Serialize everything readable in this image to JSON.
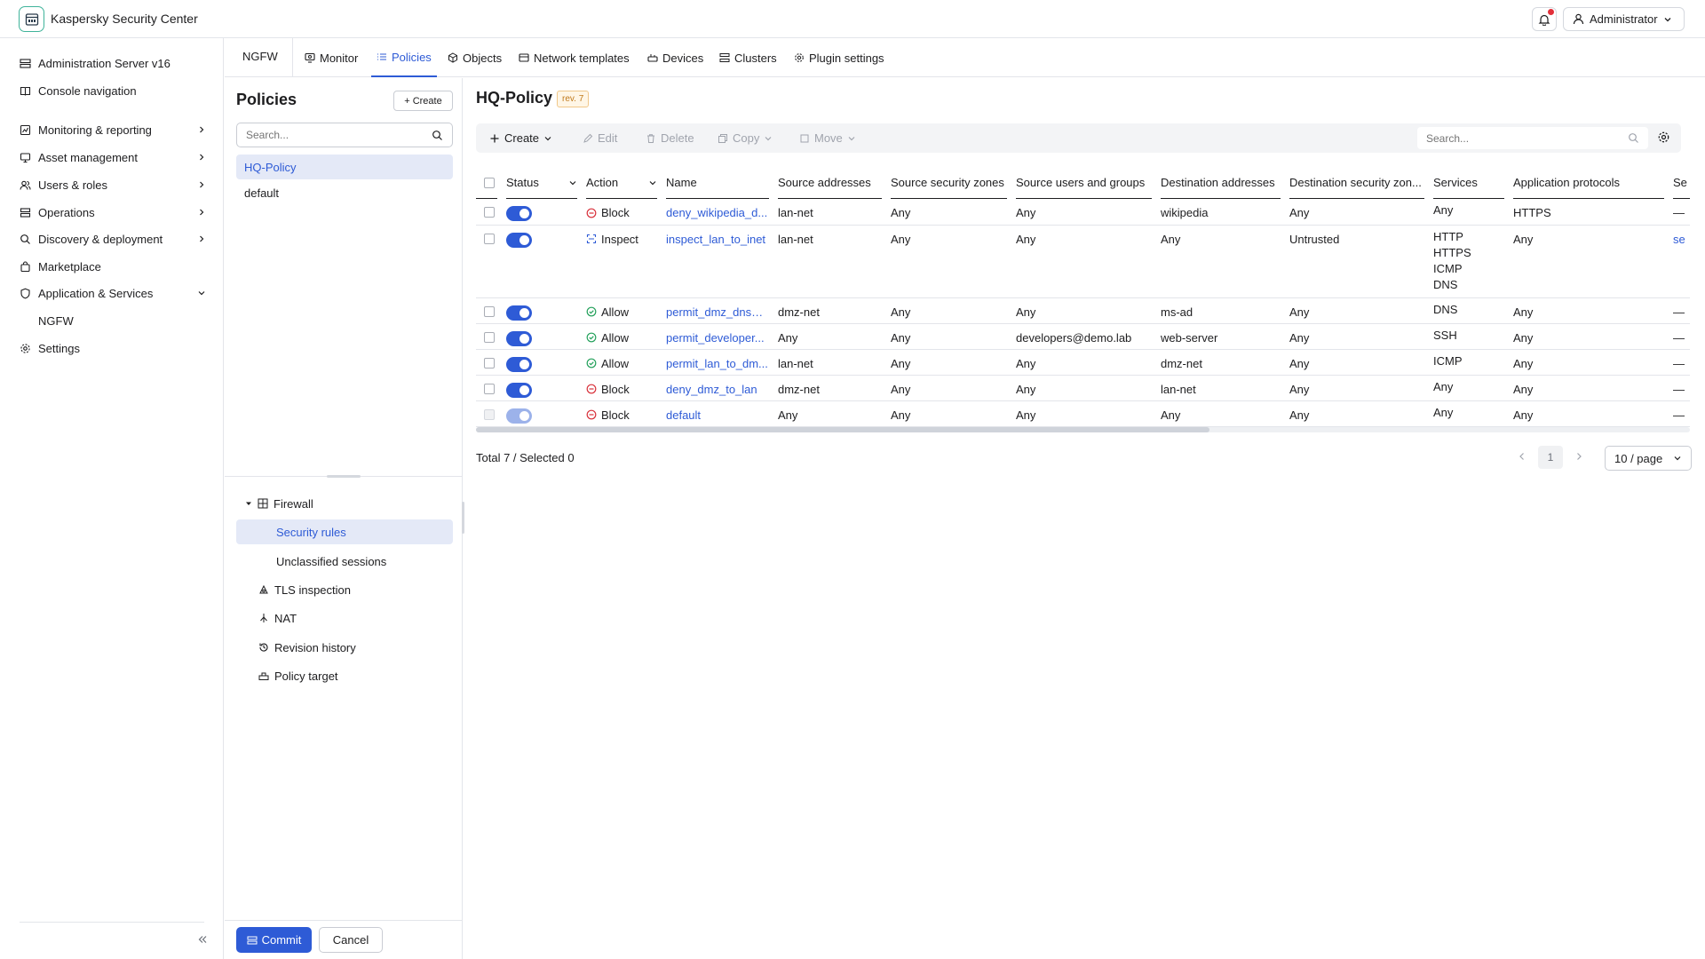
{
  "app": {
    "title": "Kaspersky Security Center",
    "accent": "#2e5bd6",
    "brand": "#3fb39a"
  },
  "header": {
    "user": "Administrator",
    "has_notification": true
  },
  "sidebar": {
    "items": [
      {
        "label": "Administration Server v16",
        "icon": "server-icon",
        "chevron": ""
      },
      {
        "label": "Console navigation",
        "icon": "book-icon",
        "chevron": ""
      },
      {
        "label": "Monitoring & reporting",
        "icon": "chart-icon",
        "chevron": "right"
      },
      {
        "label": "Asset management",
        "icon": "monitor-icon",
        "chevron": "right"
      },
      {
        "label": "Users & roles",
        "icon": "users-icon",
        "chevron": "right"
      },
      {
        "label": "Operations",
        "icon": "list-icon",
        "chevron": "right"
      },
      {
        "label": "Discovery & deployment",
        "icon": "search-icon",
        "chevron": "right"
      },
      {
        "label": "Marketplace",
        "icon": "bag-icon",
        "chevron": ""
      },
      {
        "label": "Application & Services",
        "icon": "shield-icon",
        "chevron": "down"
      },
      {
        "label": "NGFW",
        "icon": "",
        "chevron": ""
      },
      {
        "label": "Settings",
        "icon": "gear-icon",
        "chevron": ""
      }
    ]
  },
  "tabs": {
    "ngfw": "NGFW",
    "items": [
      {
        "label": "Monitor",
        "icon": "monitor-icon",
        "active": false
      },
      {
        "label": "Policies",
        "icon": "list-icon",
        "active": true
      },
      {
        "label": "Objects",
        "icon": "cube-icon",
        "active": false
      },
      {
        "label": "Network templates",
        "icon": "template-icon",
        "active": false
      },
      {
        "label": "Devices",
        "icon": "device-icon",
        "active": false
      },
      {
        "label": "Clusters",
        "icon": "cluster-icon",
        "active": false
      },
      {
        "label": "Plugin settings",
        "icon": "gear-icon",
        "active": false
      }
    ]
  },
  "policies_panel": {
    "title": "Policies",
    "create_label": "Create",
    "search_placeholder": "Search...",
    "items": [
      "HQ-Policy",
      "default"
    ],
    "selected": "HQ-Policy",
    "tree": {
      "firewall": "Firewall",
      "security_rules": "Security rules",
      "unclassified": "Unclassified sessions",
      "tls": "TLS inspection",
      "nat": "NAT",
      "revision_history": "Revision history",
      "policy_target": "Policy target"
    },
    "commit_label": "Commit",
    "cancel_label": "Cancel"
  },
  "main": {
    "title": "HQ-Policy",
    "revision": "rev. 7",
    "toolbar": {
      "create": "Create",
      "edit": "Edit",
      "delete": "Delete",
      "copy": "Copy",
      "move": "Move",
      "search_placeholder": "Search..."
    },
    "columns": [
      "Status",
      "Action",
      "Name",
      "Source addresses",
      "Source security zones",
      "Source users and groups",
      "Destination addresses",
      "Destination security zon...",
      "Services",
      "Application protocols",
      "Se"
    ],
    "rows": [
      {
        "enabled": true,
        "disabled_row": false,
        "action": "Block",
        "name": "deny_wikipedia_d...",
        "src": "lan-net",
        "src_zone": "Any",
        "src_users": "Any",
        "dst": "wikipedia",
        "dst_zone": "Any",
        "services": [
          "Any"
        ],
        "app_proto": "HTTPS",
        "extra": "—"
      },
      {
        "enabled": true,
        "disabled_row": false,
        "action": "Inspect",
        "name": "inspect_lan_to_inet",
        "src": "lan-net",
        "src_zone": "Any",
        "src_users": "Any",
        "dst": "Any",
        "dst_zone": "Untrusted",
        "services": [
          "HTTP",
          "HTTPS",
          "ICMP",
          "DNS"
        ],
        "app_proto": "Any",
        "extra": "se"
      },
      {
        "enabled": true,
        "disabled_row": false,
        "action": "Allow",
        "name": "permit_dmz_dns_ad",
        "src": "dmz-net",
        "src_zone": "Any",
        "src_users": "Any",
        "dst": "ms-ad",
        "dst_zone": "Any",
        "services": [
          "DNS"
        ],
        "app_proto": "Any",
        "extra": "—"
      },
      {
        "enabled": true,
        "disabled_row": false,
        "action": "Allow",
        "name": "permit_developer...",
        "src": "Any",
        "src_zone": "Any",
        "src_users": "developers@demo.lab",
        "dst": "web-server",
        "dst_zone": "Any",
        "services": [
          "SSH"
        ],
        "app_proto": "Any",
        "extra": "—"
      },
      {
        "enabled": true,
        "disabled_row": false,
        "action": "Allow",
        "name": "permit_lan_to_dm...",
        "src": "lan-net",
        "src_zone": "Any",
        "src_users": "Any",
        "dst": "dmz-net",
        "dst_zone": "Any",
        "services": [
          "ICMP"
        ],
        "app_proto": "Any",
        "extra": "—"
      },
      {
        "enabled": true,
        "disabled_row": false,
        "action": "Block",
        "name": "deny_dmz_to_lan",
        "src": "dmz-net",
        "src_zone": "Any",
        "src_users": "Any",
        "dst": "lan-net",
        "dst_zone": "Any",
        "services": [
          "Any"
        ],
        "app_proto": "Any",
        "extra": "—"
      },
      {
        "enabled": true,
        "disabled_row": true,
        "action": "Block",
        "name": "default",
        "src": "Any",
        "src_zone": "Any",
        "src_users": "Any",
        "dst": "Any",
        "dst_zone": "Any",
        "services": [
          "Any"
        ],
        "app_proto": "Any",
        "extra": "—"
      }
    ],
    "total_text": "Total 7 / Selected 0",
    "page": "1",
    "page_size": "10 / page"
  }
}
